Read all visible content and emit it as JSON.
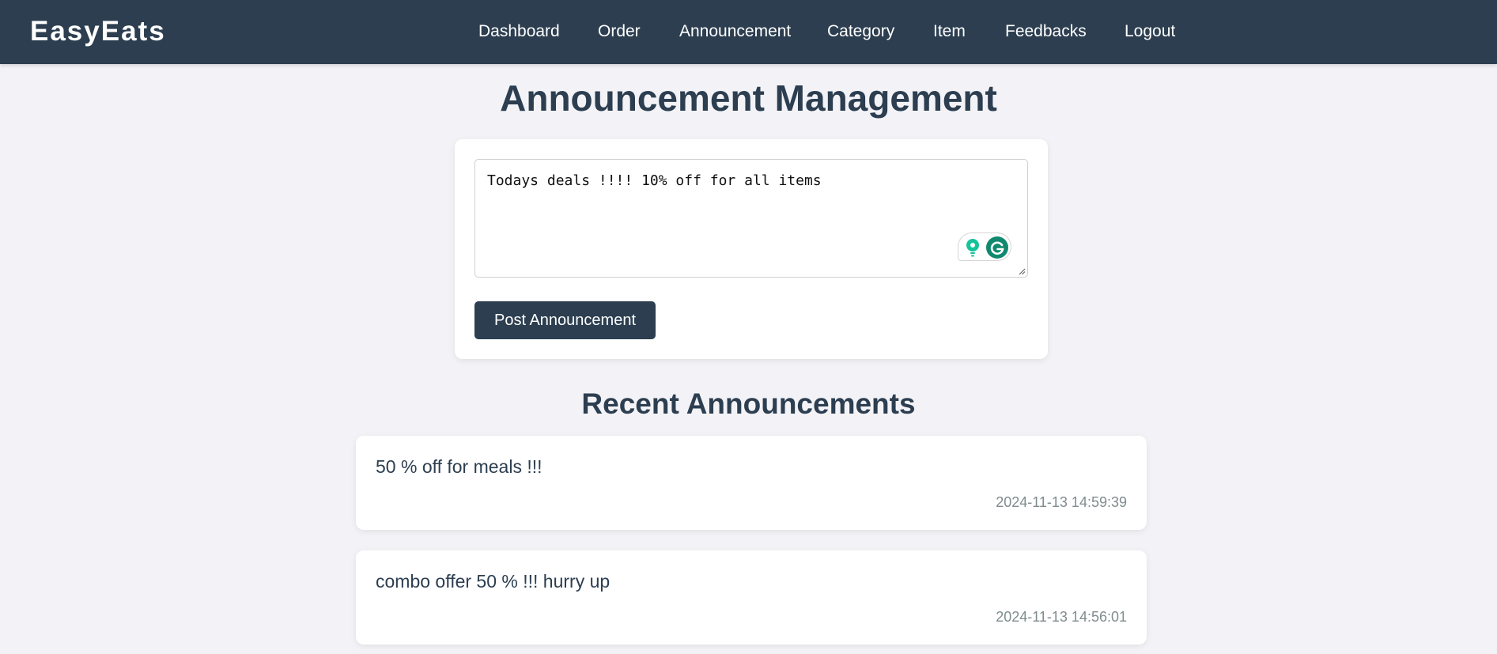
{
  "header": {
    "brand": "EasyEats",
    "nav": [
      {
        "label": "Dashboard"
      },
      {
        "label": "Order"
      },
      {
        "label": "Announcement"
      },
      {
        "label": "Category"
      },
      {
        "label": "Item"
      },
      {
        "label": "Feedbacks"
      },
      {
        "label": "Logout"
      }
    ]
  },
  "main": {
    "title": "Announcement Management",
    "form": {
      "textarea_value": "Todays deals !!!! 10% off for all items",
      "submit_label": "Post Announcement"
    },
    "recent": {
      "title": "Recent Announcements",
      "items": [
        {
          "text": "50 % off for meals !!!",
          "timestamp": "2024-11-13 14:59:39"
        },
        {
          "text": "combo offer 50 % !!! hurry up",
          "timestamp": "2024-11-13 14:56:01"
        }
      ]
    }
  },
  "icons": {
    "grammarly_bulb": "lightbulb-icon",
    "grammarly_logo": "grammarly-icon"
  },
  "colors": {
    "navbar": "#2c3e50",
    "background": "#f3f3f7",
    "accent": "#2c3e50",
    "timestamp": "#7f8c8d",
    "grammarly_green": "#15c39a"
  }
}
